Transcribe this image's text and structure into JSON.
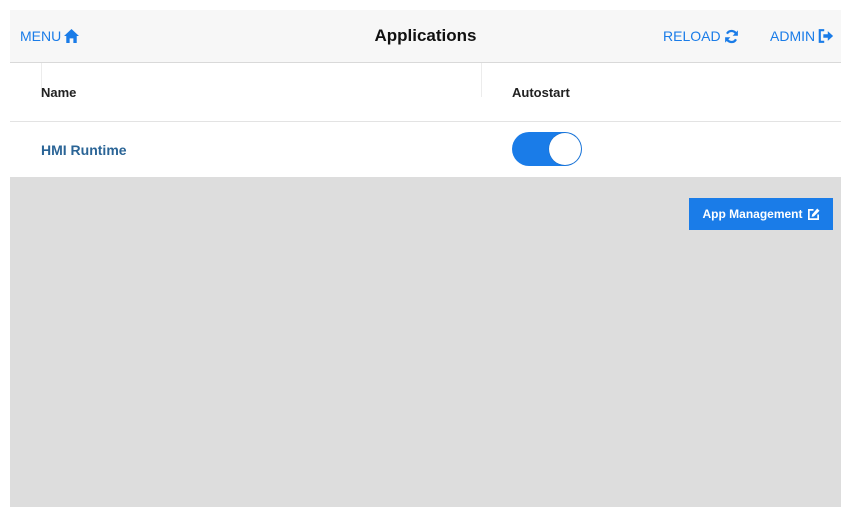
{
  "header": {
    "title": "Applications",
    "menu_label": "MENU",
    "reload_label": "RELOAD",
    "admin_label": "ADMIN",
    "menu_icon": "home-icon",
    "reload_icon": "refresh-icon",
    "admin_icon": "sign-out-icon"
  },
  "table": {
    "columns": [
      "Name",
      "Autostart"
    ],
    "rows": [
      {
        "name": "HMI Runtime",
        "autostart": true
      }
    ]
  },
  "actions": {
    "app_management_label": "App Management",
    "app_management_icon": "edit-icon"
  },
  "colors": {
    "accent": "#1a7ce8",
    "link": "#2a6496",
    "background": "#dddddd"
  }
}
